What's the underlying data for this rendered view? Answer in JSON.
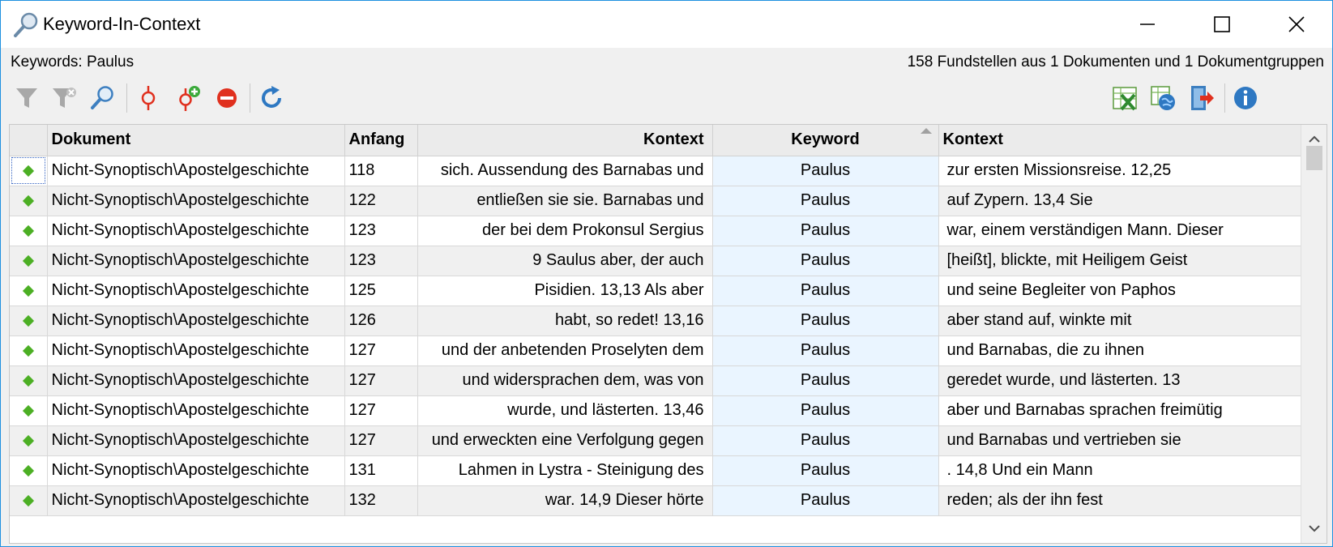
{
  "window": {
    "title": "Keyword-In-Context"
  },
  "info": {
    "keywords_label": "Keywords: Paulus",
    "summary": "158 Fundstellen aus 1 Dokumenten und 1 Dokumentgruppen"
  },
  "icons": {
    "title": "magnifier-icon",
    "toolbar_left": [
      "filter-icon",
      "clear-filter-icon",
      "search-icon",
      "keyword-marker-icon",
      "add-keyword-icon",
      "remove-icon",
      "refresh-icon"
    ],
    "toolbar_right": [
      "excel-export-icon",
      "html-export-icon",
      "export-icon",
      "info-icon"
    ]
  },
  "table": {
    "columns": {
      "dokument": "Dokument",
      "anfang": "Anfang",
      "kontext_left": "Kontext",
      "keyword": "Keyword",
      "kontext_right": "Kontext"
    },
    "rows": [
      {
        "dok": "Nicht-Synoptisch\\Apostelgeschichte",
        "anfang": "118",
        "left": "sich.   Aussendung des Barnabas und",
        "keyword": "Paulus",
        "right": "zur ersten Missionsreise.  12,25"
      },
      {
        "dok": "Nicht-Synoptisch\\Apostelgeschichte",
        "anfang": "122",
        "left": "entließen sie sie.   Barnabas und",
        "keyword": "Paulus",
        "right": "auf Zypern.  13,4 Sie"
      },
      {
        "dok": "Nicht-Synoptisch\\Apostelgeschichte",
        "anfang": "123",
        "left": "der bei dem Prokonsul Sergius",
        "keyword": "Paulus",
        "right": "war, einem verständigen Mann. Dieser"
      },
      {
        "dok": "Nicht-Synoptisch\\Apostelgeschichte",
        "anfang": "123",
        "left": "9 Saulus aber, der auch",
        "keyword": "Paulus",
        "right": "[heißt], blickte, mit Heiligem Geist"
      },
      {
        "dok": "Nicht-Synoptisch\\Apostelgeschichte",
        "anfang": "125",
        "left": "Pisidien.  13,13 Als aber",
        "keyword": "Paulus",
        "right": "und seine Begleiter von Paphos"
      },
      {
        "dok": "Nicht-Synoptisch\\Apostelgeschichte",
        "anfang": "126",
        "left": "habt, so redet! 13,16",
        "keyword": "Paulus",
        "right": "aber stand auf, winkte mit"
      },
      {
        "dok": "Nicht-Synoptisch\\Apostelgeschichte",
        "anfang": "127",
        "left": "und der anbetenden Proselyten dem",
        "keyword": "Paulus",
        "right": "und Barnabas, die zu ihnen"
      },
      {
        "dok": "Nicht-Synoptisch\\Apostelgeschichte",
        "anfang": "127",
        "left": "und widersprachen dem, was von",
        "keyword": "Paulus",
        "right": "geredet wurde, und lästerten. 13"
      },
      {
        "dok": "Nicht-Synoptisch\\Apostelgeschichte",
        "anfang": "127",
        "left": "wurde, und lästerten. 13,46",
        "keyword": "Paulus",
        "right": "aber und Barnabas sprachen freimütig"
      },
      {
        "dok": "Nicht-Synoptisch\\Apostelgeschichte",
        "anfang": "127",
        "left": "und erweckten eine Verfolgung gegen",
        "keyword": "Paulus",
        "right": "und Barnabas und vertrieben sie"
      },
      {
        "dok": "Nicht-Synoptisch\\Apostelgeschichte",
        "anfang": "131",
        "left": "Lahmen in Lystra - Steinigung des",
        "keyword": "Paulus",
        "right": ".  14,8 Und ein Mann"
      },
      {
        "dok": "Nicht-Synoptisch\\Apostelgeschichte",
        "anfang": "132",
        "left": "war. 14,9 Dieser hörte",
        "keyword": "Paulus",
        "right": "reden; als der ihn fest"
      }
    ]
  },
  "colors": {
    "accent": "#1e90e0",
    "row_marker": "#4caf24",
    "keyword_column": "#eaf5ff"
  }
}
